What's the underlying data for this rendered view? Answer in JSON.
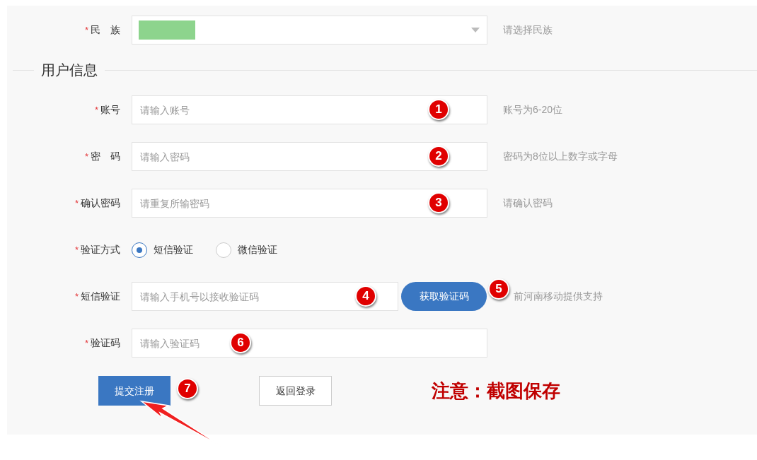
{
  "ethnicity": {
    "label": "民　族",
    "required_mark": "*",
    "hint": "请选择民族"
  },
  "section_title": "用户信息",
  "fields": [
    {
      "kind": "text",
      "label": "账号",
      "required_mark": "*",
      "placeholder": "请输入账号",
      "hint": "账号为6-20位",
      "badge": "1"
    },
    {
      "kind": "text",
      "label": "密　码",
      "required_mark": "*",
      "placeholder": "请输入密码",
      "hint": "密码为8位以上数字或字母",
      "badge": "2"
    },
    {
      "kind": "text",
      "label": "确认密码",
      "required_mark": "*",
      "placeholder": "请重复所输密码",
      "hint": "请确认密码",
      "badge": "3"
    },
    {
      "kind": "radio",
      "label": "验证方式",
      "required_mark": "*",
      "options": [
        {
          "label": "短信验证",
          "selected": true
        },
        {
          "label": "微信验证",
          "selected": false
        }
      ]
    },
    {
      "kind": "sms",
      "label": "短信验证",
      "required_mark": "*",
      "placeholder": "请输入手机号以接收验证码",
      "badge": "4",
      "button": "获取验证码",
      "button_badge": "5",
      "hint": "前河南移动提供支持"
    },
    {
      "kind": "code",
      "label": "验证码",
      "required_mark": "*",
      "placeholder": "请输入验证码",
      "badge": "6"
    }
  ],
  "submit": {
    "label": "提交注册",
    "badge": "7"
  },
  "back": {
    "label": "返回登录"
  },
  "note": "注意：截图保存"
}
